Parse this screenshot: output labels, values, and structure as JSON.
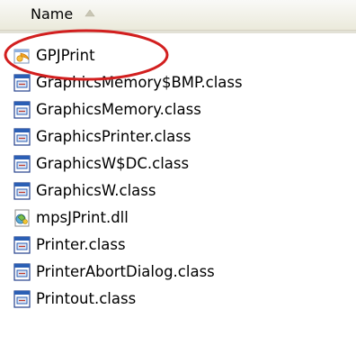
{
  "header": {
    "column_name": "Name",
    "sort_direction": "ascending",
    "sort_icon": "sort-ascending-icon"
  },
  "files": [
    {
      "name": "GPJPrint",
      "icon": "java-launcher-icon"
    },
    {
      "name": "GraphicsMemory$BMP.class",
      "icon": "class-file-icon"
    },
    {
      "name": "GraphicsMemory.class",
      "icon": "class-file-icon"
    },
    {
      "name": "GraphicsPrinter.class",
      "icon": "class-file-icon"
    },
    {
      "name": "GraphicsW$DC.class",
      "icon": "class-file-icon"
    },
    {
      "name": "GraphicsW.class",
      "icon": "class-file-icon"
    },
    {
      "name": "mpsJPrint.dll",
      "icon": "dll-file-icon"
    },
    {
      "name": "Printer.class",
      "icon": "class-file-icon"
    },
    {
      "name": "PrinterAbortDialog.class",
      "icon": "class-file-icon"
    },
    {
      "name": "Printout.class",
      "icon": "class-file-icon"
    }
  ],
  "annotation": {
    "highlighted_item": "GPJPrint",
    "ring_color": "#d21f1f"
  },
  "colors": {
    "header_bg_top": "#f9f9f7",
    "header_bg_bottom": "#ebeadb",
    "class_icon_blue": "#2b5fb5"
  }
}
